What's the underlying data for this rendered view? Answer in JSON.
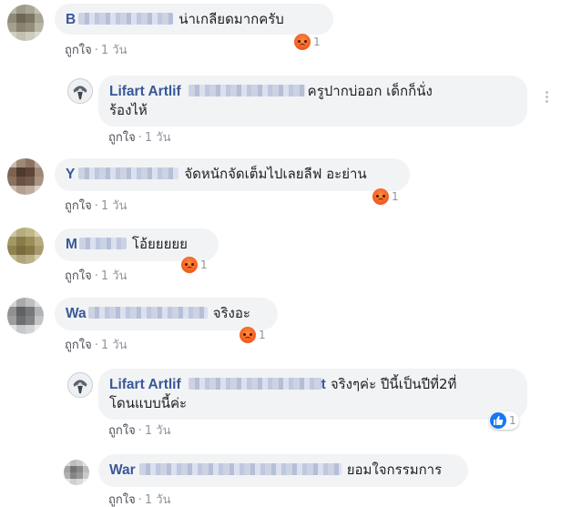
{
  "comments": [
    {
      "name": "B",
      "text": "น่าเกลียดมากครับ",
      "reaction_count": "1",
      "action_like": "ถูกใจ",
      "action_time": "1 วัน"
    },
    {
      "name": "Lifart Artlif",
      "text_line1": "ครูปากบ่ออก เด็กก็นั่ง",
      "text_line2": "ร้องไห้",
      "action_like": "ถูกใจ",
      "action_time": "1 วัน"
    },
    {
      "name": "Y",
      "text": "จัดหนักจัดเต็มไปเลยลีฟ อะย่าน",
      "reaction_count": "1",
      "action_like": "ถูกใจ",
      "action_time": "1 วัน"
    },
    {
      "name": "M",
      "text": "โอ้ยยยยย",
      "reaction_count": "1",
      "action_like": "ถูกใจ",
      "action_time": "1 วัน"
    },
    {
      "name": "Wa",
      "text": "จริงอะ",
      "reaction_count": "1",
      "action_like": "ถูกใจ",
      "action_time": "1 วัน"
    },
    {
      "name": "Lifart Artlif",
      "name_tail": "t",
      "text_line1": "จริงๆค่ะ ปีนี้เป็นปีที่2ที่",
      "text_line2": "โดนแบบนี้ค่ะ",
      "reaction_count": "1",
      "action_like": "ถูกใจ",
      "action_time": "1 วัน"
    },
    {
      "name": "War",
      "text": "ยอมใจกรรมการ",
      "action_like": "ถูกใจ",
      "action_time": "1 วัน"
    }
  ],
  "icons": {
    "angry": "angry-reaction-icon",
    "like": "like-reaction-icon",
    "more": "more-options-icon"
  },
  "colors": {
    "name": "#385898",
    "bubble": "#f2f3f5",
    "meta": "#90949c",
    "like_blue": "#1877f2"
  }
}
